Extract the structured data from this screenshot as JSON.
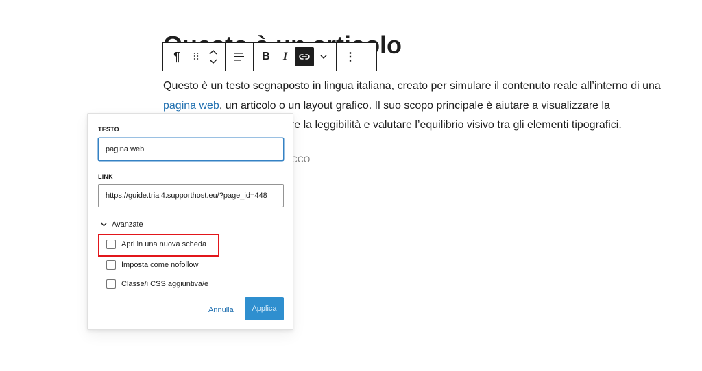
{
  "article": {
    "title": "Questo è un articolo",
    "paragraph": {
      "line1": "Questo è un testo segnaposto in lingua italiana, creato per simulare il contenuto reale all’interno di una",
      "link_text": "pagina web",
      "line2_rest": ", un articolo o un layout grafico. Il suo scopo principale è aiutare a visualizzare la",
      "line3_visible": "care la leggibilità e valutare l’equilibrio visivo tra gli elementi tipografici."
    },
    "faded_fragment": "CCO"
  },
  "toolbar": {
    "paragraph_icon": "¶",
    "drag_icon": "⠿",
    "bold_label": "B",
    "italic_label": "I",
    "more_icon": "⋮"
  },
  "link_popover": {
    "text_label": "TESTO",
    "text_value": "pagina web",
    "link_label": "LINK",
    "link_value": "https://guide.trial4.supporthost.eu/?page_id=448",
    "advanced_label": "Avanzate",
    "options": {
      "new_tab": "Apri in una nuova scheda",
      "nofollow": "Imposta come nofollow",
      "css_class": "Classe/i CSS aggiuntiva/e"
    },
    "cancel_label": "Annulla",
    "apply_label": "Applica"
  },
  "colors": {
    "link": "#2271b1",
    "apply_button": "#2f8fcf",
    "focus_border": "#3582c4",
    "highlight": "#e2161b"
  }
}
